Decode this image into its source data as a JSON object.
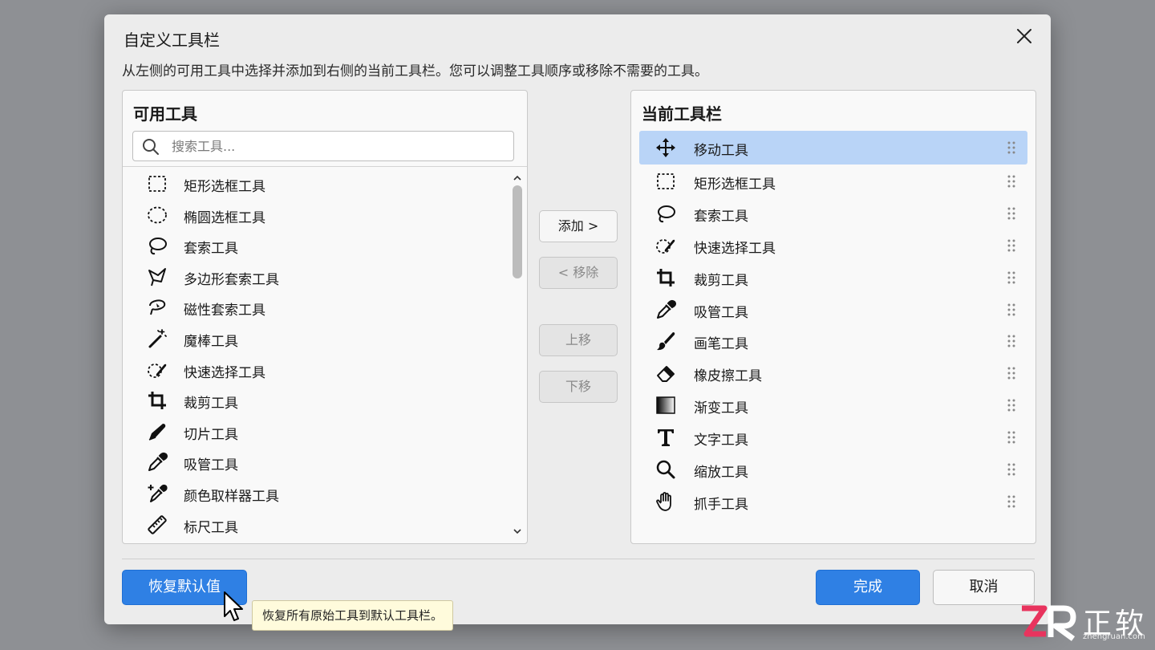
{
  "dialog": {
    "title": "自定义工具栏",
    "subtitle": "从左侧的可用工具中选择并添加到右侧的当前工具栏。您可以调整工具顺序或移除不需要的工具。"
  },
  "available": {
    "title": "可用工具",
    "search_placeholder": "搜索工具...",
    "items": [
      {
        "label": "矩形选框工具",
        "icon": "rect-marquee-icon"
      },
      {
        "label": "椭圆选框工具",
        "icon": "ellipse-marquee-icon"
      },
      {
        "label": "套索工具",
        "icon": "lasso-icon"
      },
      {
        "label": "多边形套索工具",
        "icon": "polygon-lasso-icon"
      },
      {
        "label": "磁性套索工具",
        "icon": "magnetic-lasso-icon"
      },
      {
        "label": "魔棒工具",
        "icon": "magic-wand-icon"
      },
      {
        "label": "快速选择工具",
        "icon": "quick-select-icon"
      },
      {
        "label": "裁剪工具",
        "icon": "crop-icon"
      },
      {
        "label": "切片工具",
        "icon": "slice-icon"
      },
      {
        "label": "吸管工具",
        "icon": "eyedropper-icon"
      },
      {
        "label": "颜色取样器工具",
        "icon": "color-sampler-icon"
      },
      {
        "label": "标尺工具",
        "icon": "ruler-icon"
      }
    ]
  },
  "current": {
    "title": "当前工具栏",
    "items": [
      {
        "label": "移动工具",
        "icon": "move-icon",
        "selected": true
      },
      {
        "label": "矩形选框工具",
        "icon": "rect-marquee-icon"
      },
      {
        "label": "套索工具",
        "icon": "lasso-icon"
      },
      {
        "label": "快速选择工具",
        "icon": "quick-select-icon"
      },
      {
        "label": "裁剪工具",
        "icon": "crop-icon"
      },
      {
        "label": "吸管工具",
        "icon": "eyedropper-icon"
      },
      {
        "label": "画笔工具",
        "icon": "brush-icon"
      },
      {
        "label": "橡皮擦工具",
        "icon": "eraser-icon"
      },
      {
        "label": "渐变工具",
        "icon": "gradient-icon"
      },
      {
        "label": "文字工具",
        "icon": "text-icon"
      },
      {
        "label": "缩放工具",
        "icon": "zoom-icon"
      },
      {
        "label": "抓手工具",
        "icon": "hand-icon"
      }
    ]
  },
  "actions": {
    "add": "添加 >",
    "remove": "< 移除",
    "move_up": "上移",
    "move_down": "下移"
  },
  "footer": {
    "restore": "恢复默认值",
    "done": "完成",
    "cancel": "取消",
    "tooltip": "恢复所有原始工具到默认工具栏。"
  },
  "watermark": {
    "name": "正软",
    "url": "zhengruan.com"
  },
  "colors": {
    "accent": "#2f80e4",
    "selection": "#b9d4f7",
    "tooltip_bg": "#fffbdc"
  }
}
